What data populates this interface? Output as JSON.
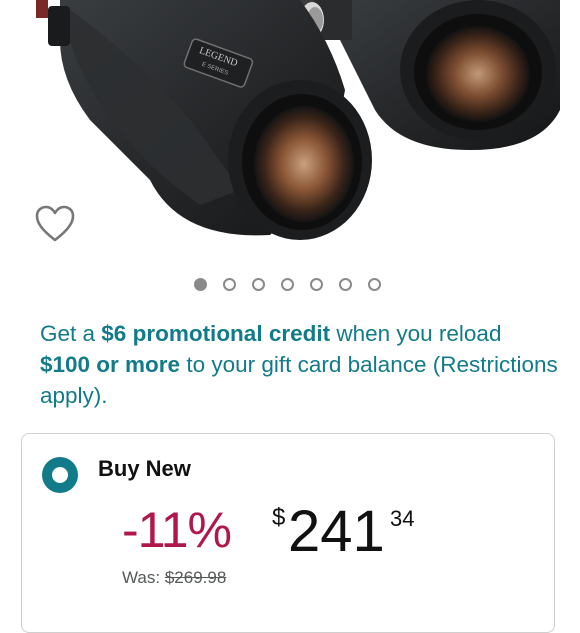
{
  "product": {
    "image_label": "binoculars-product-image",
    "brand_badge": "LEGEND",
    "series_text": "E SERIES",
    "gallery_total": 7,
    "gallery_active_index": 0
  },
  "promo": {
    "lead": "Get a ",
    "credit": "$6 promotional credit",
    "mid": " when you reload ",
    "amount": "$100 or more",
    "tail": " to your gift card balance (Restrictions apply)."
  },
  "offer": {
    "option_label": "Buy New",
    "discount": "-11%",
    "currency": "$",
    "price_whole": "241",
    "price_fraction": "34",
    "was_label": "Was: ",
    "was_price": "$269.98"
  },
  "colors": {
    "accent": "#127b8a",
    "discount": "#b0184a",
    "text": "#111111"
  }
}
